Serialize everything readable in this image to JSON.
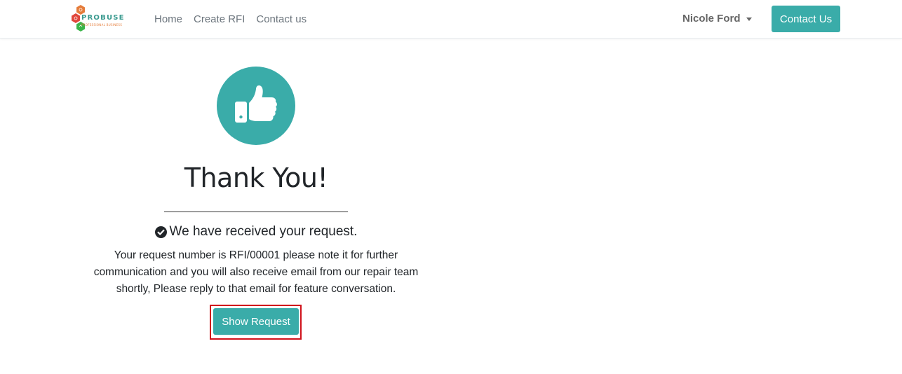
{
  "brand": {
    "name": "PROBUSE",
    "tagline": "PROFESSIONAL BUSINESS",
    "logo_icon": "hexagon-logo-icon",
    "colors": [
      "#e57c3a",
      "#e0463b",
      "#3bb54a"
    ]
  },
  "nav": {
    "links": [
      {
        "label": "Home"
      },
      {
        "label": "Create RFI"
      },
      {
        "label": "Contact us"
      }
    ],
    "user_name": "Nicole Ford",
    "contact_button": "Contact Us"
  },
  "main": {
    "icon": "thumbs-up-icon",
    "title": "Thank You!",
    "received_text": "We have received your request.",
    "received_icon": "check-circle-icon",
    "message": "Your request number is RFI/00001 please note it for further communication and you will also receive email from our repair team shortly, Please reply to that email for feature conversation.",
    "show_button": "Show Request"
  },
  "colors": {
    "accent": "#3aaca9",
    "highlight_border": "#d0121b"
  }
}
